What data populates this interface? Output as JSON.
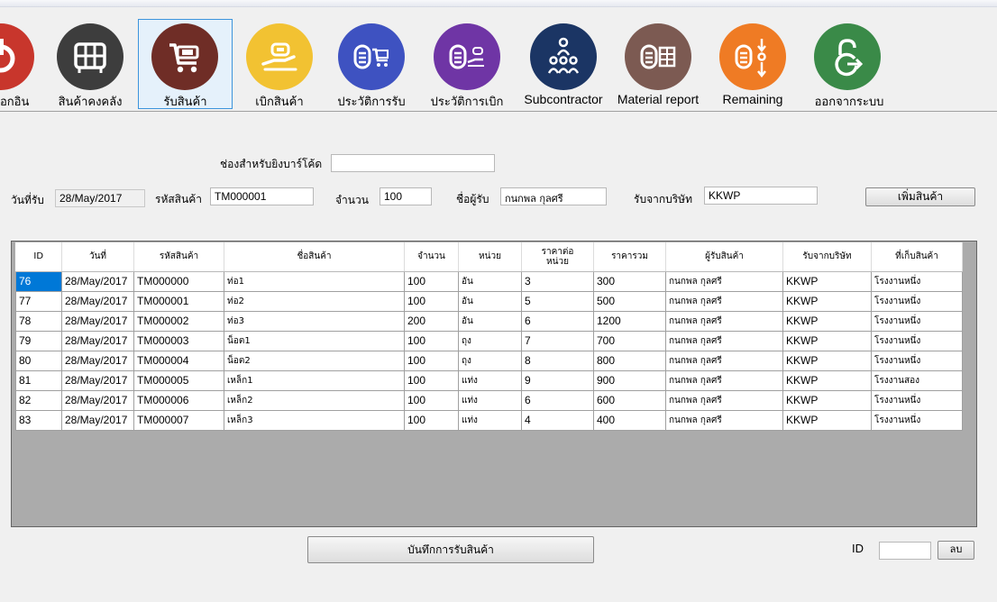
{
  "toolbar": {
    "items": [
      {
        "label": "อกอิน",
        "icon": "exit-door-icon",
        "color": "#c8362c"
      },
      {
        "label": "สินค้าคงคลัง",
        "icon": "warehouse-shelf-icon",
        "color": "#3d3d3d"
      },
      {
        "label": "รับสินค้า",
        "icon": "cart-receive-icon",
        "color": "#6f2d26"
      },
      {
        "label": "เบิกสินค้า",
        "icon": "hand-give-icon",
        "color": "#f2c232"
      },
      {
        "label": "ประวัติการรับ",
        "icon": "receive-history-icon",
        "color": "#3e52c1"
      },
      {
        "label": "ประวัติการเบิก",
        "icon": "issue-history-icon",
        "color": "#6f35a5"
      },
      {
        "label": "Subcontractor",
        "icon": "team-icon",
        "color": "#1b3564"
      },
      {
        "label": "Material report",
        "icon": "report-grid-icon",
        "color": "#7c5a52"
      },
      {
        "label": "Remaining",
        "icon": "remaining-arrows-icon",
        "color": "#ef7b24"
      },
      {
        "label": "ออกจากระบบ",
        "icon": "logout-lock-icon",
        "color": "#3a8a48"
      }
    ]
  },
  "form": {
    "barcode_label": "ช่องสำหรับยิงบาร์โค้ด",
    "barcode_value": "",
    "date_label": "วันที่รับ",
    "date_value": "28/May/2017",
    "code_label": "รหัสสินค้า",
    "code_value": "TM000001",
    "qty_label": "จำนวน",
    "qty_value": "100",
    "receiver_label": "ชื่อผู้รับ",
    "receiver_value": "กนกพล กุลศรี",
    "company_label": "รับจากบริษัท",
    "company_value": "KKWP",
    "add_button": "เพิ่มสินค้า"
  },
  "table": {
    "columns": [
      "ID",
      "วันที่",
      "รหัสสินค้า",
      "ชื่อสินค้า",
      "จำนวน",
      "หน่วย",
      "ราคาต่อ\nหน่วย",
      "ราคารวม",
      "ผู้รับสินค้า",
      "รับจากบริษัท",
      "ที่เก็บสินค้า"
    ],
    "rows": [
      [
        "76",
        "28/May/2017",
        "TM000000",
        "ท่อ1",
        "100",
        "อัน",
        "3",
        "300",
        "กนกพล กุลศรี",
        "KKWP",
        "โรงงานหนึ่ง"
      ],
      [
        "77",
        "28/May/2017",
        "TM000001",
        "ท่อ2",
        "100",
        "อัน",
        "5",
        "500",
        "กนกพล กุลศรี",
        "KKWP",
        "โรงงานหนึ่ง"
      ],
      [
        "78",
        "28/May/2017",
        "TM000002",
        "ท่อ3",
        "200",
        "อัน",
        "6",
        "1200",
        "กนกพล กุลศรี",
        "KKWP",
        "โรงงานหนึ่ง"
      ],
      [
        "79",
        "28/May/2017",
        "TM000003",
        "น็อต1",
        "100",
        "ถุง",
        "7",
        "700",
        "กนกพล กุลศรี",
        "KKWP",
        "โรงงานหนึ่ง"
      ],
      [
        "80",
        "28/May/2017",
        "TM000004",
        "น็อต2",
        "100",
        "ถุง",
        "8",
        "800",
        "กนกพล กุลศรี",
        "KKWP",
        "โรงงานหนึ่ง"
      ],
      [
        "81",
        "28/May/2017",
        "TM000005",
        "เหล็ก1",
        "100",
        "แท่ง",
        "9",
        "900",
        "กนกพล กุลศรี",
        "KKWP",
        "โรงงานสอง"
      ],
      [
        "82",
        "28/May/2017",
        "TM000006",
        "เหล็ก2",
        "100",
        "แท่ง",
        "6",
        "600",
        "กนกพล กุลศรี",
        "KKWP",
        "โรงงานหนึ่ง"
      ],
      [
        "83",
        "28/May/2017",
        "TM000007",
        "เหล็ก3",
        "100",
        "แท่ง",
        "4",
        "400",
        "กนกพล กุลศรี",
        "KKWP",
        "โรงงานหนึ่ง"
      ]
    ],
    "selected_row": 0
  },
  "footer": {
    "save_button": "บันทึกการรับสินค้า",
    "id_label": "ID",
    "id_value": "",
    "delete_button": "ลบ"
  }
}
